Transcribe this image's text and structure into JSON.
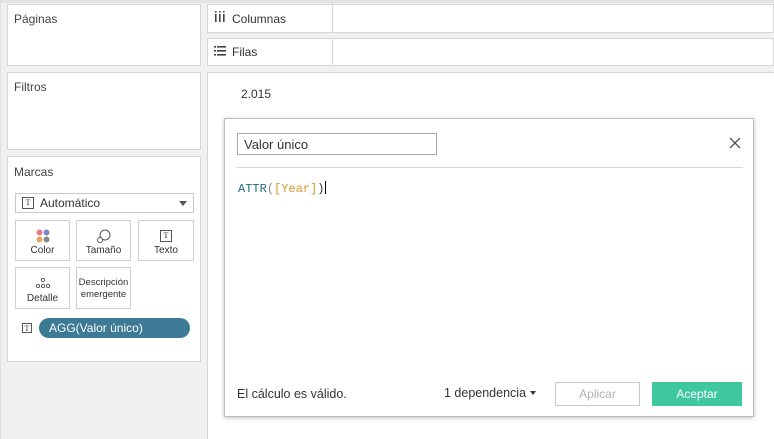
{
  "panes": {
    "paginas": "Páginas",
    "filtros": "Filtros",
    "marcas": "Marcas"
  },
  "marks": {
    "type": "Automático",
    "buttons": {
      "color": "Color",
      "tamano": "Tamaño",
      "texto": "Texto",
      "detalle": "Detalle",
      "descripcion_line1": "Descripción",
      "descripcion_line2": "emergente"
    },
    "pill": "AGG(Valor único)",
    "colors": {
      "pill": "#3d7a96"
    }
  },
  "shelves": {
    "columnas": "Columnas",
    "filas": "Filas"
  },
  "view": {
    "value": "2.015"
  },
  "dialog": {
    "name": "Valor único",
    "formula_fn": "ATTR",
    "formula_open": "(",
    "formula_field": "[Year]",
    "formula_close": ")",
    "status": "El cálculo es válido.",
    "dependencies": "1 dependencia",
    "apply": "Aplicar",
    "ok": "Aceptar",
    "colors": {
      "ok": "#3fc79f"
    }
  }
}
